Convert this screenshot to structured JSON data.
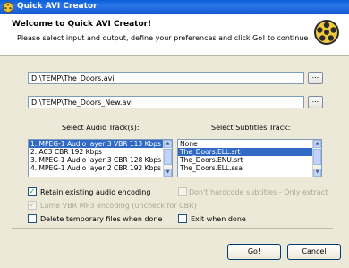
{
  "window": {
    "title": "Quick AVI Creator"
  },
  "header": {
    "title": "Welcome to Quick AVI Creator!",
    "subtitle": "Please select input and output, define your preferences and click Go! to continue"
  },
  "input": {
    "value": "D:\\TEMP\\The_Doors.avi",
    "browse_label": "..."
  },
  "output": {
    "value": "D:\\TEMP\\The_Doors_New.avi",
    "browse_label": "..."
  },
  "audio": {
    "label": "Select Audio Track(s):",
    "items": [
      "1. MPEG-1 Audio layer 3 VBR 113 Kbps",
      "2. AC3 CBR 192 Kbps",
      "3. MPEG-1 Audio layer 3 CBR 128 Kbps",
      "4. MPEG-1 Audio layer 2 CBR 192 Kbps"
    ]
  },
  "subtitles": {
    "label": "Select Subtitles Track:",
    "items": [
      "None",
      "The_Doors.ELL.srt",
      "The_Doors.ENU.srt",
      "The_Doors.ELL.ssa"
    ]
  },
  "options": {
    "retain_audio": "Retain existing audio encoding",
    "dont_hardcode": "Don't hardcode subtitles - Only extract",
    "lame_vbr": "Lame VBR MP3 encoding (uncheck for CBR)",
    "delete_temp": "Delete temporary files when done",
    "exit_when_done": "Exit when done"
  },
  "buttons": {
    "go": "Go!",
    "cancel": "Cancel"
  }
}
